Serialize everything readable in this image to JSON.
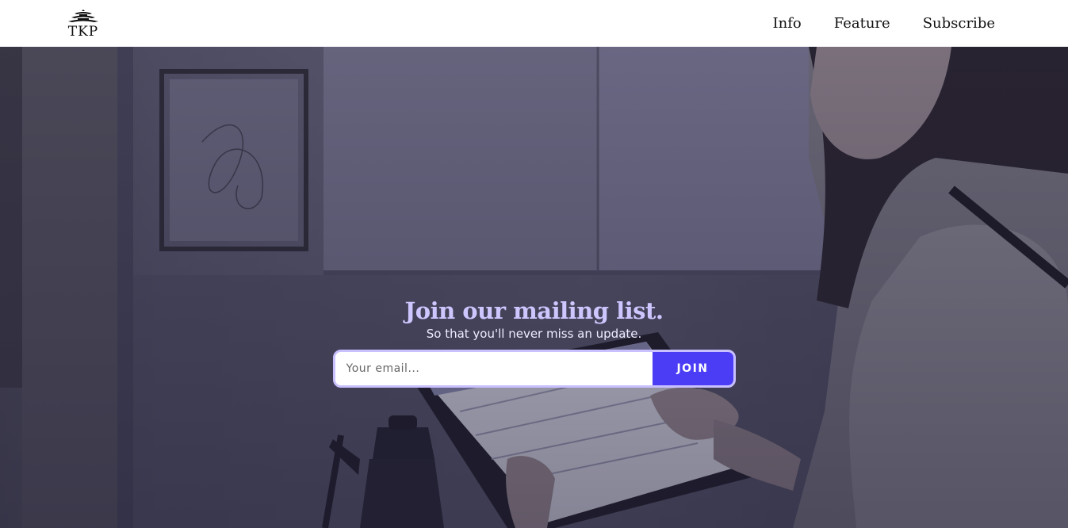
{
  "header": {
    "logo_text": "TKP",
    "nav": [
      {
        "label": "Info"
      },
      {
        "label": "Feature"
      },
      {
        "label": "Subscribe"
      }
    ]
  },
  "hero": {
    "title": "Join our mailing list.",
    "subtitle": "So that you'll never miss an update.",
    "email_placeholder": "Your email...",
    "email_value": "",
    "join_label": "JOIN"
  },
  "colors": {
    "title": "#cdc6ff",
    "button": "#4a3df5",
    "form_border": "#c8c0ff"
  },
  "icons": {
    "logo": "pagoda-icon"
  }
}
